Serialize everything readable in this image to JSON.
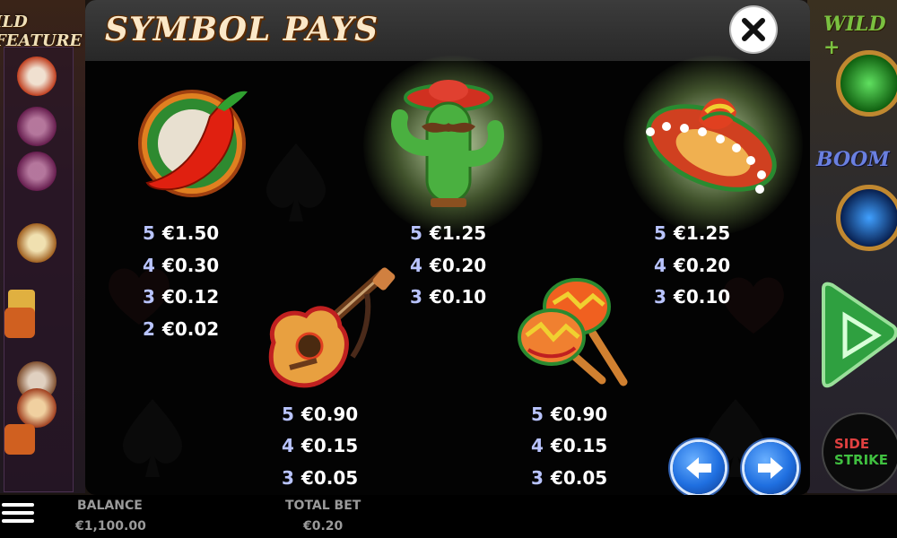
{
  "game": {
    "left_feature_label": "ILD FEATURE",
    "wild_label": "WILD +",
    "boom_label": "BOOM",
    "side_strike": {
      "line1": "SIDE",
      "line2": "STRIKE"
    }
  },
  "panel": {
    "title": "SYMBOL PAYS",
    "close_icon": "close-icon"
  },
  "symbols": [
    {
      "name": "chili-pepper",
      "pays": [
        {
          "count": "5",
          "value": "€1.50"
        },
        {
          "count": "4",
          "value": "€0.30"
        },
        {
          "count": "3",
          "value": "€0.12"
        },
        {
          "count": "2",
          "value": "€0.02"
        }
      ]
    },
    {
      "name": "cactus",
      "pays": [
        {
          "count": "5",
          "value": "€1.25"
        },
        {
          "count": "4",
          "value": "€0.20"
        },
        {
          "count": "3",
          "value": "€0.10"
        }
      ]
    },
    {
      "name": "sombrero",
      "pays": [
        {
          "count": "5",
          "value": "€1.25"
        },
        {
          "count": "4",
          "value": "€0.20"
        },
        {
          "count": "3",
          "value": "€0.10"
        }
      ]
    },
    {
      "name": "guitar",
      "pays": [
        {
          "count": "5",
          "value": "€0.90"
        },
        {
          "count": "4",
          "value": "€0.15"
        },
        {
          "count": "3",
          "value": "€0.05"
        }
      ]
    },
    {
      "name": "maracas",
      "pays": [
        {
          "count": "5",
          "value": "€0.90"
        },
        {
          "count": "4",
          "value": "€0.15"
        },
        {
          "count": "3",
          "value": "€0.05"
        }
      ]
    }
  ],
  "navigation": {
    "prev_icon": "arrow-left-icon",
    "next_icon": "arrow-right-icon"
  },
  "footer": {
    "balance_label": "BALANCE",
    "balance_value": "€1,100.00",
    "total_bet_label": "TOTAL BET",
    "total_bet_value": "€0.20"
  },
  "colors": {
    "count": "#b9c4ff",
    "value": "#ffffff",
    "nav_button": "#1f6fe0",
    "glow": "#e6ffc8"
  }
}
